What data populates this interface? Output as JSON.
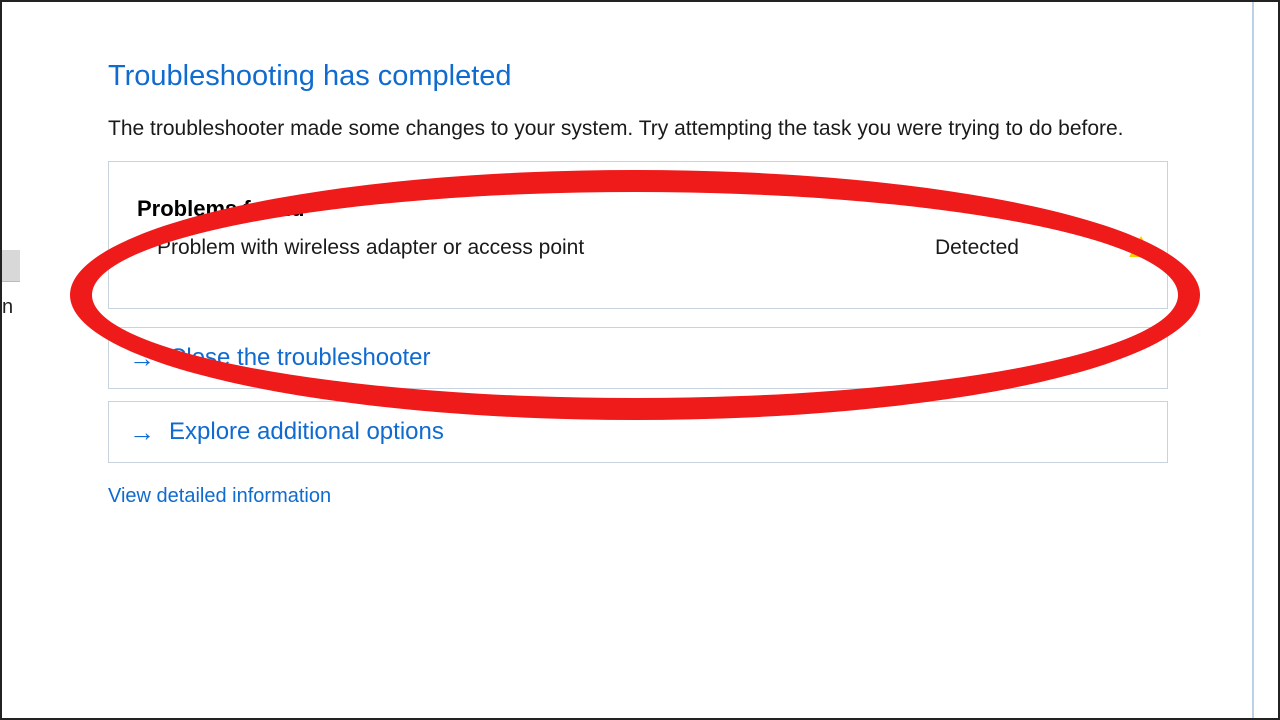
{
  "title": "Troubleshooting has completed",
  "description": "The troubleshooter made some changes to your system. Try attempting the task you were trying to do before.",
  "problems": {
    "heading": "Problems found",
    "items": [
      {
        "text": "Problem with wireless adapter or access point",
        "status": "Detected"
      }
    ]
  },
  "actions": {
    "close": "Close the troubleshooter",
    "explore": "Explore additional options"
  },
  "detail_link": "View detailed information",
  "sidebar_fragment": "n",
  "annotation": {
    "shape": "red-ellipse",
    "purpose": "highlight-problems-found"
  },
  "colors": {
    "accent": "#0f6bd0",
    "annotation": "#ef1a1a",
    "warning": "#ffcc00"
  }
}
